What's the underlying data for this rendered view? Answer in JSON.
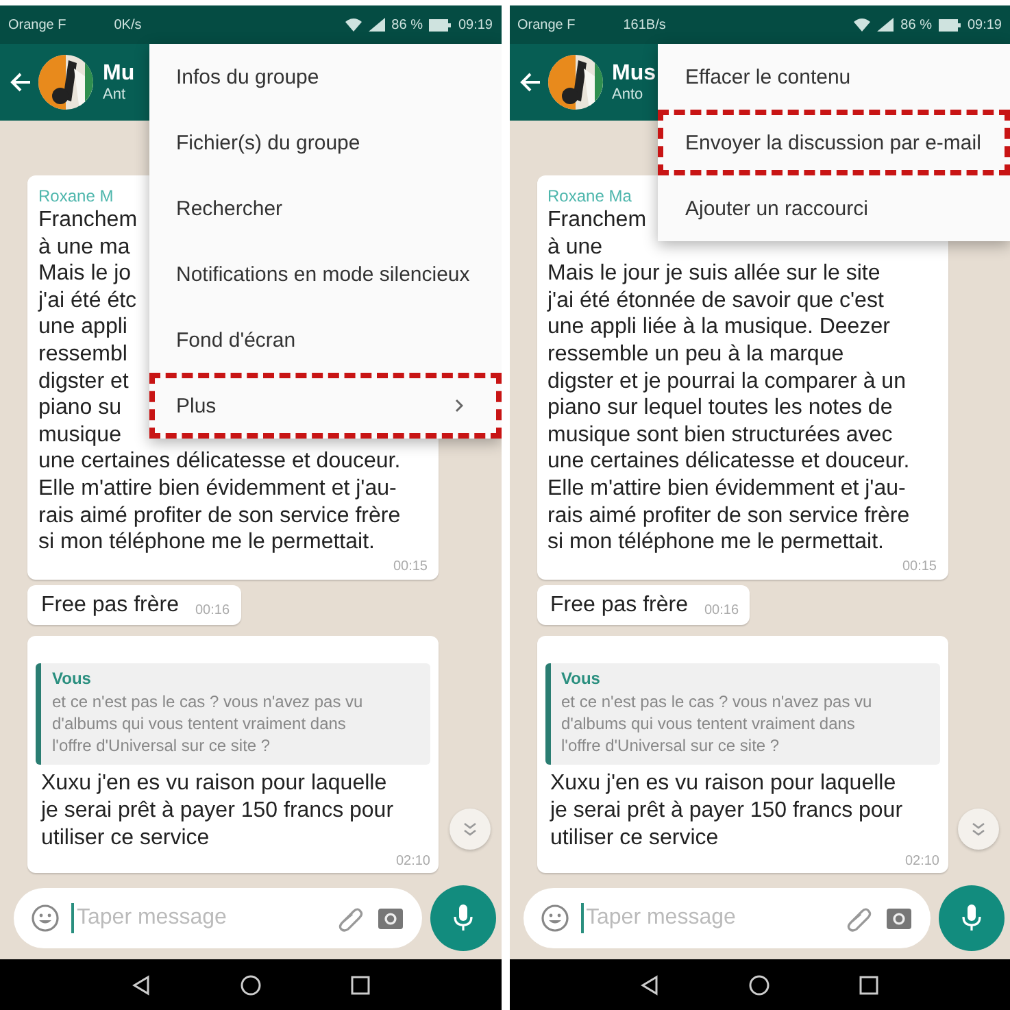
{
  "panels": [
    {
      "status_bar": {
        "carrier": "Orange F",
        "speed": "0K/s",
        "battery": "86 %",
        "time": "09:19"
      },
      "header": {
        "title": "Mu",
        "subtitle": "Ant"
      },
      "menu": [
        {
          "label": "Infos du groupe",
          "highlighted": false,
          "submenu": false
        },
        {
          "label": "Fichier(s) du groupe",
          "highlighted": false,
          "submenu": false
        },
        {
          "label": "Rechercher",
          "highlighted": false,
          "submenu": false
        },
        {
          "label": "Notifications en mode silencieux",
          "highlighted": false,
          "submenu": false
        },
        {
          "label": "Fond d'écran",
          "highlighted": false,
          "submenu": false
        },
        {
          "label": "Plus",
          "highlighted": true,
          "submenu": true
        }
      ],
      "messages": [
        {
          "kind": "group",
          "sender": "Roxane M",
          "lines": [
            "Franchem",
            "à une ma",
            "Mais le jo",
            "j'ai été étc",
            "une appli",
            "ressembl",
            "digster et",
            "piano su",
            "musique",
            "une certaines délicatesse et douceur.",
            "Elle m'attire bien évidemment et j'au-",
            "rais aimé profiter de son service frère",
            "si mon téléphone me le permettait."
          ],
          "time": "00:15"
        },
        {
          "kind": "short",
          "lines": [
            "Free pas frère"
          ],
          "time": "00:16"
        },
        {
          "kind": "reply",
          "quote_author": "Vous",
          "quote_lines": [
            "et ce n'est pas le cas ? vous n'avez pas vu",
            "d'albums qui vous tentent vraiment dans",
            "l'offre d'Universal sur ce site ?"
          ],
          "lines": [
            "Xuxu j'en es vu raison pour laquelle",
            "je serai prêt à payer 150 francs pour",
            "utiliser ce service"
          ],
          "time": "02:10"
        }
      ],
      "input": {
        "placeholder": "Taper message"
      }
    },
    {
      "status_bar": {
        "carrier": "Orange F",
        "speed": "161B/s",
        "battery": "86 %",
        "time": "09:19"
      },
      "header": {
        "title": "Mus",
        "subtitle": "Anto"
      },
      "menu": [
        {
          "label": "Effacer le contenu",
          "highlighted": false,
          "submenu": false
        },
        {
          "label": "Envoyer la discussion par e-mail",
          "highlighted": true,
          "submenu": false
        },
        {
          "label": "Ajouter un raccourci",
          "highlighted": false,
          "submenu": false
        }
      ],
      "messages": [
        {
          "kind": "group",
          "sender": "Roxane Ma",
          "lines": [
            "Franchem",
            "à une",
            "Mais le jour je suis allée sur le site",
            "j'ai été étonnée de savoir que c'est",
            "une appli liée à la musique. Deezer",
            "ressemble un peu à la marque",
            "digster et je pourrai la comparer  à un",
            "piano sur lequel toutes les notes de",
            "musique sont bien structurées avec",
            "une certaines délicatesse et douceur.",
            "Elle m'attire bien évidemment et j'au-",
            "rais aimé profiter de son service frère",
            "si mon téléphone me le permettait."
          ],
          "time": "00:15"
        },
        {
          "kind": "short",
          "lines": [
            "Free pas frère"
          ],
          "time": "00:16"
        },
        {
          "kind": "reply",
          "quote_author": "Vous",
          "quote_lines": [
            "et ce n'est pas le cas ? vous n'avez pas vu",
            "d'albums qui vous tentent vraiment dans",
            "l'offre d'Universal sur ce site ?"
          ],
          "lines": [
            "Xuxu j'en es vu raison pour laquelle",
            "je serai prêt à payer 150 francs pour",
            "utiliser ce service"
          ],
          "time": "02:10"
        }
      ],
      "input": {
        "placeholder": "Taper message"
      }
    }
  ]
}
